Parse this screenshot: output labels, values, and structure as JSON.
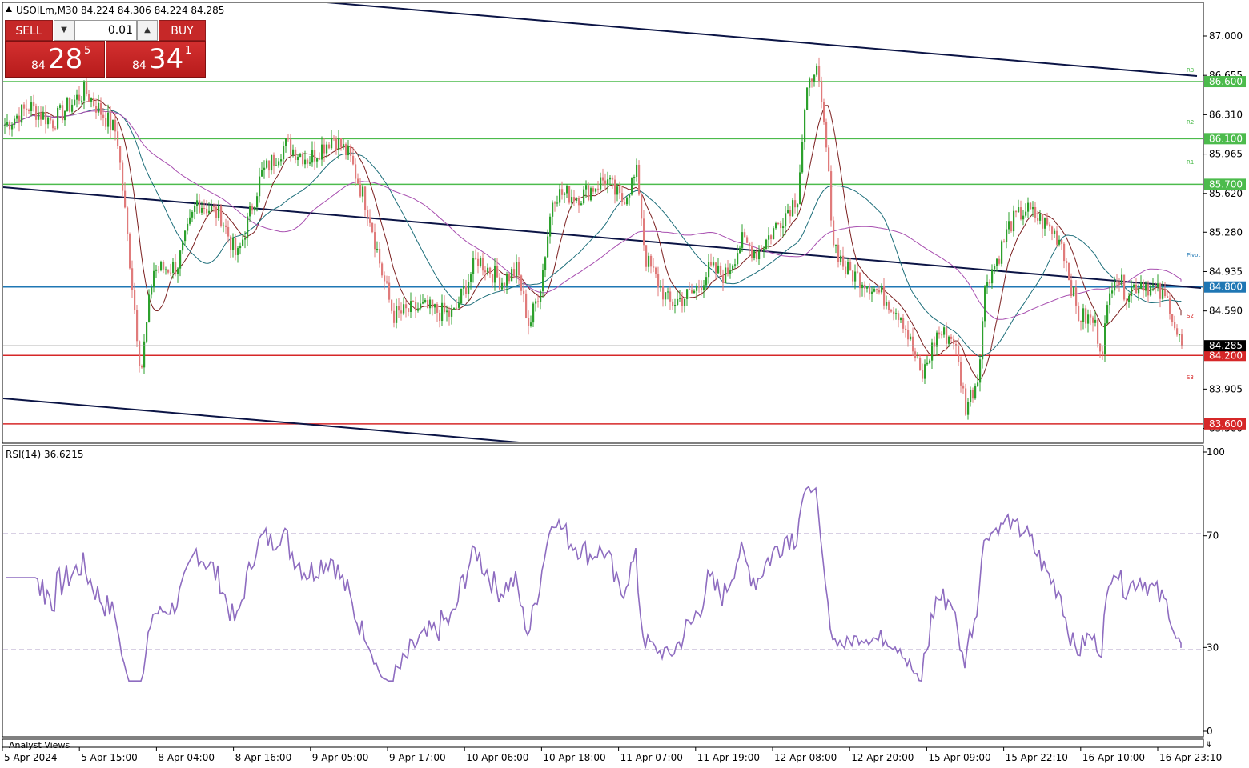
{
  "header": {
    "symbol_line": "USOILm,M30  84.224 84.306 84.224 84.285"
  },
  "trade_panel": {
    "sell_label": "SELL",
    "buy_label": "BUY",
    "lot_value": "0.01",
    "sell_price": {
      "small": "84",
      "big": "28",
      "sup": "5"
    },
    "buy_price": {
      "small": "84",
      "big": "34",
      "sup": "1"
    }
  },
  "price_axis": {
    "ticks": [
      "87.000",
      "86.655",
      "86.310",
      "85.965",
      "85.620",
      "85.280",
      "84.935",
      "84.590",
      "83.905",
      "83.560"
    ],
    "current_price": "84.285"
  },
  "levels": [
    {
      "label": "86.600",
      "color": "#4cbb4c",
      "tag": "R3"
    },
    {
      "label": "86.100",
      "color": "#4cbb4c",
      "tag": "R2"
    },
    {
      "label": "85.700",
      "color": "#4cbb4c",
      "tag": "R1"
    },
    {
      "label": "84.800",
      "color": "#1f77b4",
      "tag": "Pivot"
    },
    {
      "label": "84.200",
      "color": "#d62728",
      "tag": "S2"
    },
    {
      "label": "83.600",
      "color": "#d62728",
      "tag": "S3"
    }
  ],
  "rsi": {
    "title": "RSI(14) 36.6215",
    "ticks": [
      "100",
      "70",
      "30",
      "0"
    ],
    "color": "#8e6cc0"
  },
  "footer": {
    "analyst_views": "Analyst Views",
    "time_labels": [
      "5 Apr 2024",
      "5 Apr 15:00",
      "8 Apr 04:00",
      "8 Apr 16:00",
      "9 Apr 05:00",
      "9 Apr 17:00",
      "10 Apr 06:00",
      "10 Apr 18:00",
      "11 Apr 07:00",
      "11 Apr 19:00",
      "12 Apr 08:00",
      "12 Apr 20:00",
      "15 Apr 09:00",
      "15 Apr 22:10",
      "16 Apr 10:00",
      "16 Apr 23:10"
    ]
  },
  "colors": {
    "bull": "#2ca02c",
    "bear": "#e07b7b",
    "trend": "#0b1445"
  },
  "chart_data": {
    "type": "candlestick",
    "symbol": "USOILm",
    "timeframe": "M30",
    "ohlc_last": {
      "open": 84.224,
      "high": 84.306,
      "low": 84.224,
      "close": 84.285
    },
    "ylim": [
      83.5,
      87.1
    ],
    "levels": [
      86.6,
      86.1,
      85.7,
      84.8,
      84.2,
      83.6
    ],
    "rsi_last": 36.6215,
    "rsi_levels": [
      70,
      30
    ],
    "close_path": [
      [
        0,
        86.22
      ],
      [
        30,
        86.38
      ],
      [
        60,
        86.25
      ],
      [
        100,
        86.52
      ],
      [
        140,
        86.15
      ],
      [
        170,
        84.05
      ],
      [
        185,
        84.95
      ],
      [
        215,
        84.98
      ],
      [
        240,
        85.55
      ],
      [
        270,
        85.42
      ],
      [
        290,
        85.05
      ],
      [
        320,
        85.78
      ],
      [
        350,
        86.05
      ],
      [
        380,
        85.92
      ],
      [
        410,
        86.12
      ],
      [
        430,
        85.95
      ],
      [
        455,
        85.45
      ],
      [
        470,
        84.95
      ],
      [
        485,
        84.55
      ],
      [
        520,
        84.62
      ],
      [
        560,
        84.55
      ],
      [
        590,
        85.05
      ],
      [
        620,
        84.85
      ],
      [
        640,
        84.95
      ],
      [
        655,
        84.45
      ],
      [
        670,
        84.85
      ],
      [
        685,
        85.62
      ],
      [
        720,
        85.6
      ],
      [
        750,
        85.75
      ],
      [
        770,
        85.55
      ],
      [
        790,
        85.8
      ],
      [
        800,
        85.05
      ],
      [
        830,
        84.65
      ],
      [
        860,
        84.75
      ],
      [
        880,
        84.95
      ],
      [
        900,
        84.9
      ],
      [
        920,
        85.2
      ],
      [
        940,
        85.1
      ],
      [
        970,
        85.4
      ],
      [
        990,
        85.6
      ],
      [
        1000,
        86.4
      ],
      [
        1012,
        86.78
      ],
      [
        1025,
        86.1
      ],
      [
        1035,
        85.2
      ],
      [
        1050,
        84.95
      ],
      [
        1075,
        84.85
      ],
      [
        1100,
        84.7
      ],
      [
        1120,
        84.55
      ],
      [
        1145,
        84.0
      ],
      [
        1165,
        84.4
      ],
      [
        1185,
        84.35
      ],
      [
        1200,
        83.75
      ],
      [
        1215,
        84.0
      ],
      [
        1225,
        84.85
      ],
      [
        1240,
        85.05
      ],
      [
        1255,
        85.35
      ],
      [
        1275,
        85.48
      ],
      [
        1300,
        85.35
      ],
      [
        1320,
        85.2
      ],
      [
        1340,
        84.55
      ],
      [
        1360,
        84.5
      ],
      [
        1370,
        84.25
      ],
      [
        1385,
        84.95
      ],
      [
        1400,
        84.75
      ],
      [
        1420,
        84.85
      ],
      [
        1440,
        84.75
      ],
      [
        1455,
        84.65
      ],
      [
        1465,
        84.35
      ],
      [
        1475,
        84.285
      ]
    ]
  }
}
